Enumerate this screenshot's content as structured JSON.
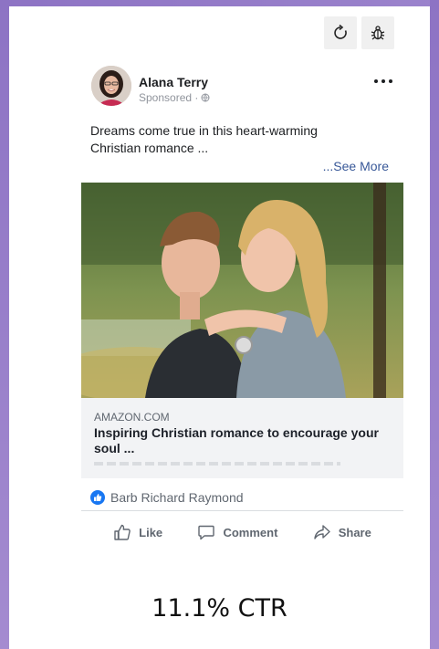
{
  "post": {
    "author": "Alana Terry",
    "sponsored_label": "Sponsored ·",
    "text": "Dreams come true in this heart-warming Christian romance ...",
    "see_more": "...See More"
  },
  "link_preview": {
    "domain": "AMAZON.COM",
    "headline": "Inspiring Christian romance to encourage your soul ..."
  },
  "reactions": {
    "reactor_names": "Barb Richard Raymond"
  },
  "actions": {
    "like": "Like",
    "comment": "Comment",
    "share": "Share"
  },
  "stat": {
    "ctr": "11.1% CTR"
  },
  "colors": {
    "frame": "#9b83cc",
    "link": "#385898",
    "like_blue": "#1877f2",
    "link_box_bg": "#f2f3f5"
  },
  "icons": {
    "toolbar": [
      "refresh-icon",
      "bug-icon"
    ],
    "header": [
      "globe-icon",
      "more-options-icon"
    ],
    "actions": [
      "thumbs-up-icon",
      "comment-icon",
      "share-icon"
    ]
  }
}
